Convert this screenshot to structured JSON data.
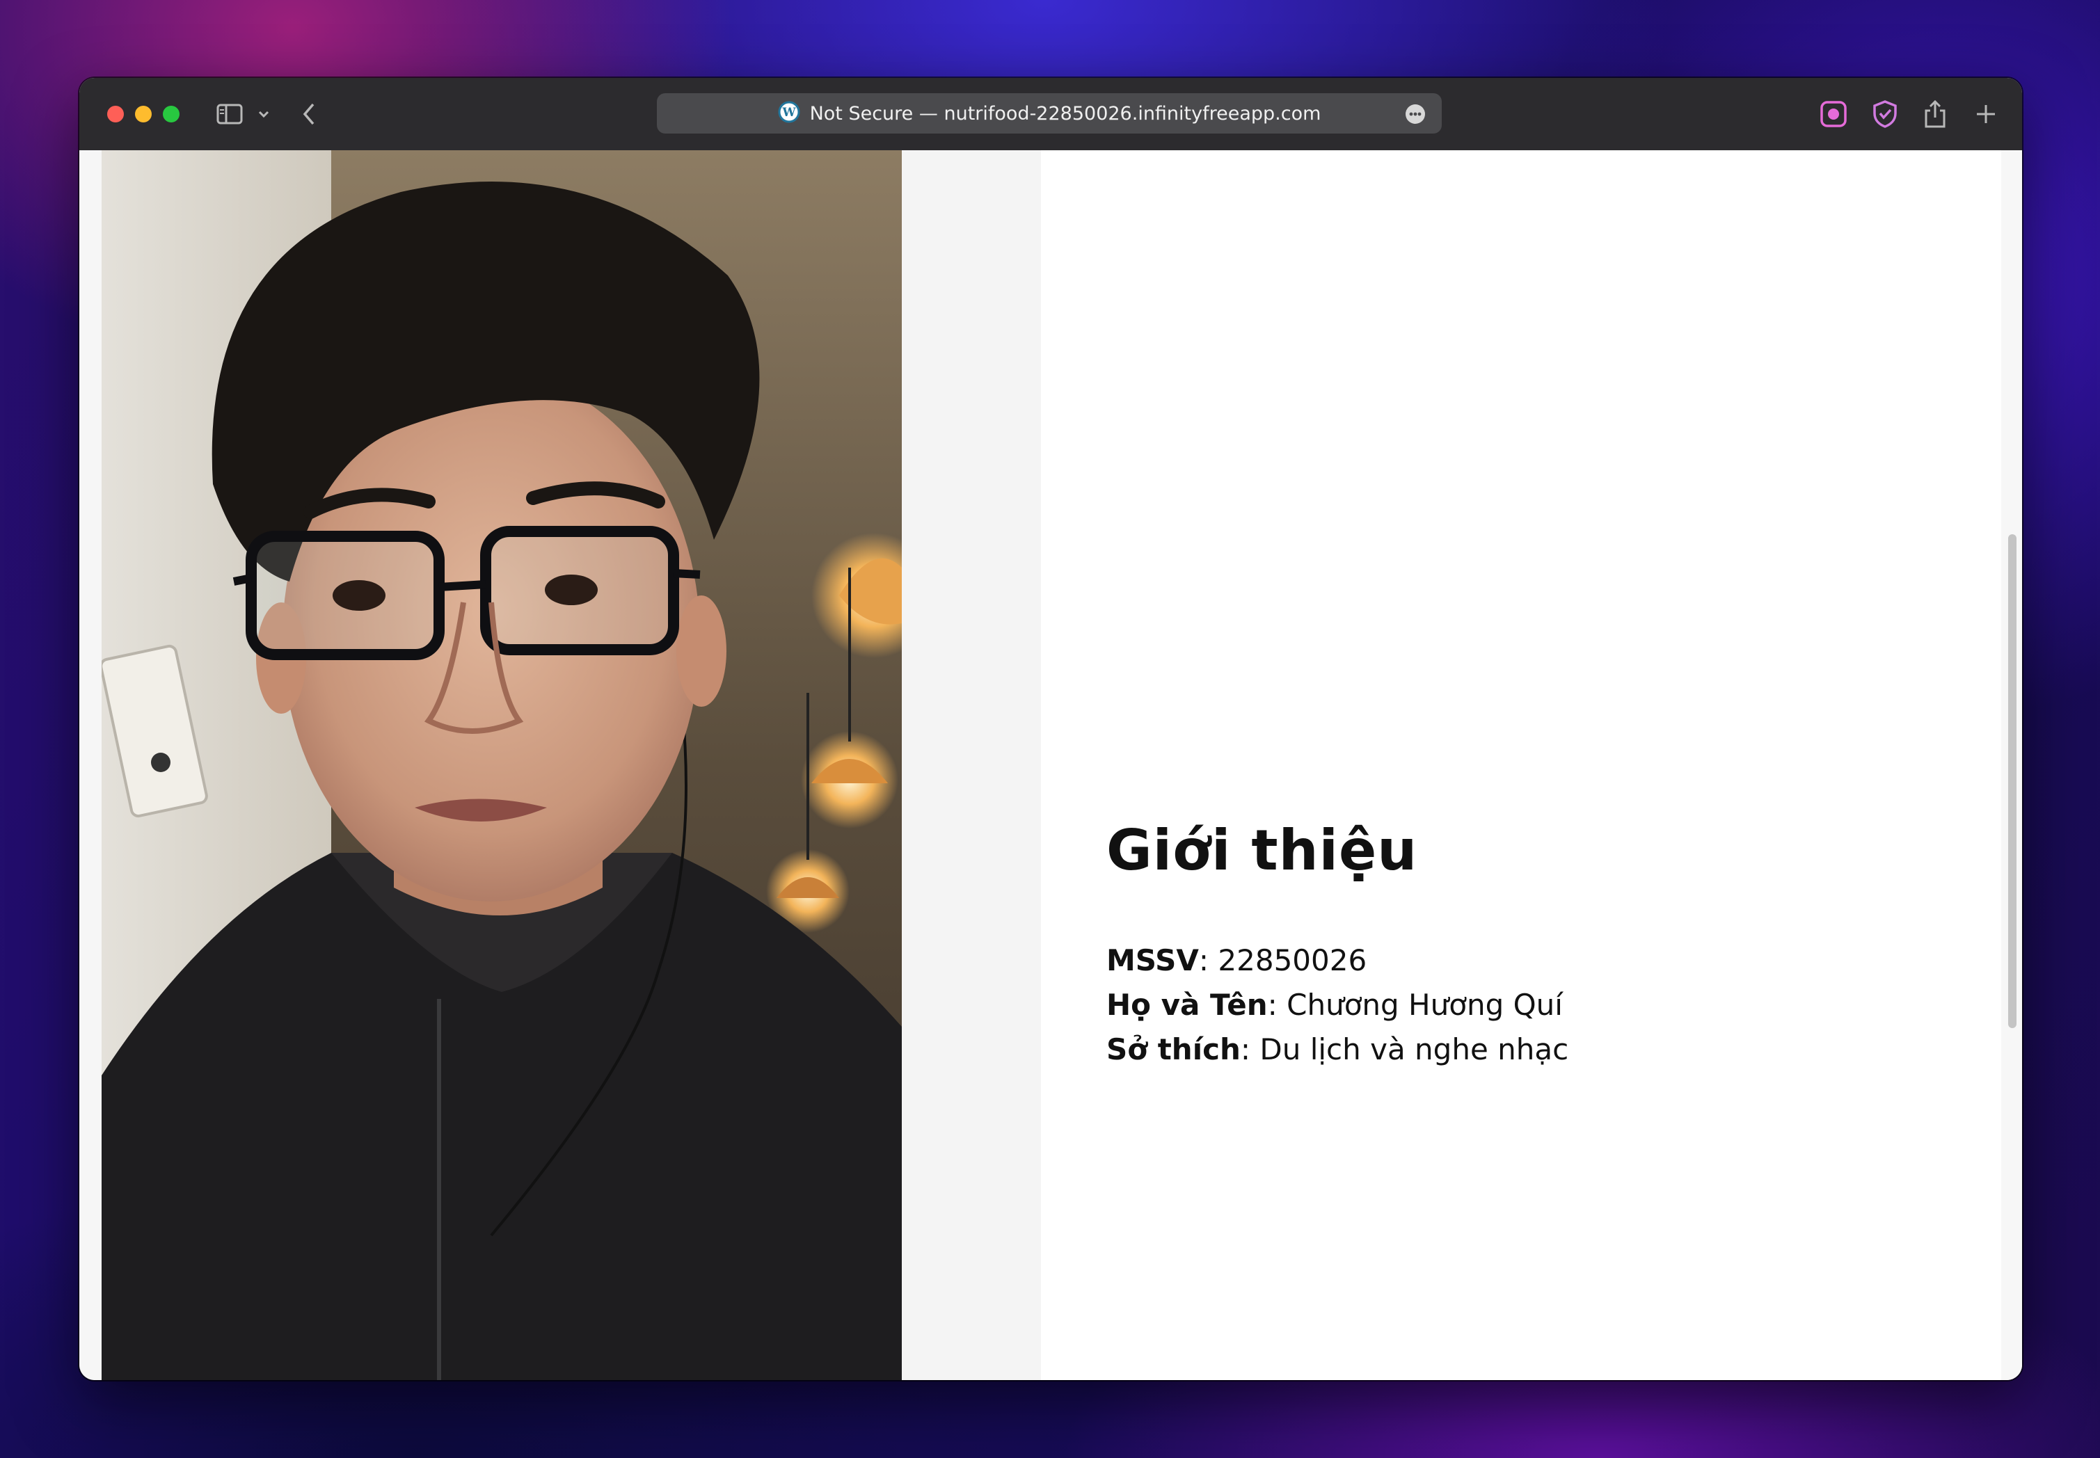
{
  "browser": {
    "url_prefix": "Not Secure —",
    "url": "nutrifood-22850026.infinityfreeapp.com",
    "site_icon": "wordpress-icon",
    "toolbar_icons": [
      "sidebar-icon",
      "chevron-down-icon",
      "back-icon",
      "more-icon",
      "screen-record-icon",
      "shield-check-icon",
      "share-icon",
      "new-tab-icon"
    ]
  },
  "page": {
    "photo_alt": "portrait-photo",
    "heading": "Giới thiệu",
    "info": [
      {
        "label": "MSSV",
        "value": ": 22850026"
      },
      {
        "label": "Họ và Tên",
        "value": ": Chương Hương Quí"
      },
      {
        "label": "Sở thích",
        "value": ": Du lịch và nghe nhạc"
      }
    ]
  },
  "colors": {
    "toolbar": "#2c2b2e",
    "address_bar": "#4a4a4d",
    "accent_pink": "#e56bd8"
  }
}
